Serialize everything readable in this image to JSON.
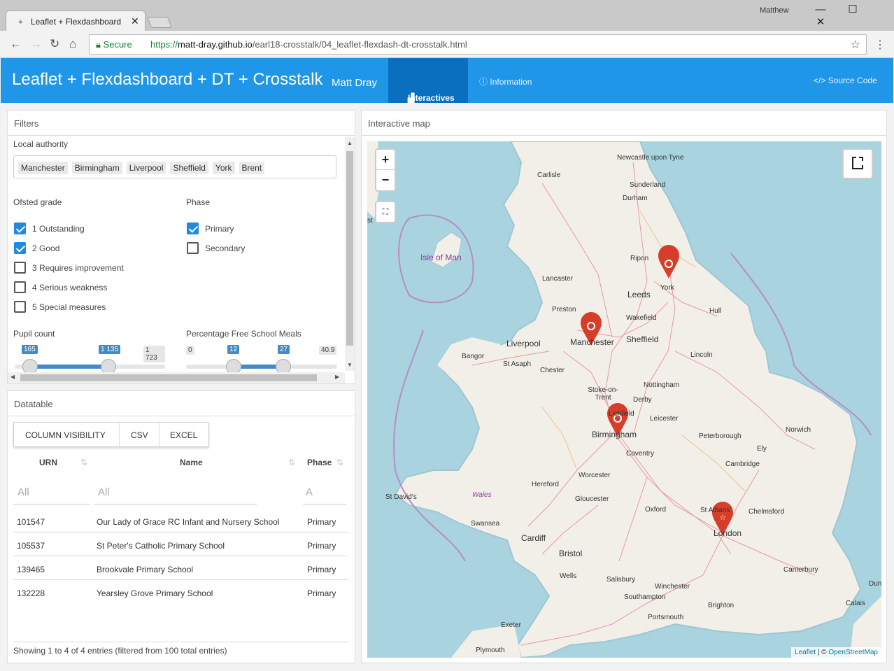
{
  "browser": {
    "tab_title": "Leaflet + Flexdashboard",
    "user": "Matthew",
    "secure_label": "Secure",
    "url_scheme": "https://",
    "url_host": "matt-dray.github.io",
    "url_path": "/earl18-crosstalk/04_leaflet-flexdash-dt-crosstalk.html"
  },
  "header": {
    "title": "Leaflet + Flexdashboard + DT + Crosstalk",
    "author": "Matt Dray",
    "nav_interactives": "Interactives",
    "nav_information": "Information",
    "source_code": "Source Code",
    "color": "#1f96e8"
  },
  "filters": {
    "title": "Filters",
    "local_authority_label": "Local authority",
    "local_authorities": [
      "Manchester",
      "Birmingham",
      "Liverpool",
      "Sheffield",
      "York",
      "Brent"
    ],
    "ofsted_label": "Ofsted grade",
    "ofsted": [
      {
        "label": "1 Outstanding",
        "checked": true
      },
      {
        "label": "2 Good",
        "checked": true
      },
      {
        "label": "3 Requires improvement",
        "checked": false
      },
      {
        "label": "4 Serious weakness",
        "checked": false
      },
      {
        "label": "5 Special measures",
        "checked": false
      }
    ],
    "phase_label": "Phase",
    "phase": [
      {
        "label": "Primary",
        "checked": true
      },
      {
        "label": "Secondary",
        "checked": false
      }
    ],
    "pupil_label": "Pupil count",
    "pupil": {
      "min": "165",
      "from": "165",
      "to": "1 135",
      "max": "1 723"
    },
    "fsm_label": "Percentage Free School Meals",
    "fsm": {
      "min": "0",
      "from": "12",
      "to": "27",
      "max": "40.9"
    }
  },
  "datatable": {
    "title": "Datatable",
    "buttons": [
      "COLUMN VISIBILITY",
      "CSV",
      "EXCEL"
    ],
    "columns": [
      "URN",
      "Name",
      "Phase"
    ],
    "filter_placeholders": [
      "All",
      "All",
      "A"
    ],
    "rows": [
      {
        "urn": "101547",
        "name": "Our Lady of Grace RC Infant and Nursery School",
        "phase": "Primary"
      },
      {
        "urn": "105537",
        "name": "St Peter's Catholic Primary School",
        "phase": "Primary"
      },
      {
        "urn": "139465",
        "name": "Brookvale Primary School",
        "phase": "Primary"
      },
      {
        "urn": "132228",
        "name": "Yearsley Grove Primary School",
        "phase": "Primary"
      }
    ],
    "info": "Showing 1 to 4 of 4 entries (filtered from 100 total entries)"
  },
  "map": {
    "title": "Interactive map",
    "zoom_in": "+",
    "zoom_out": "−",
    "attribution_leaflet": "Leaflet",
    "attribution_sep": " | © ",
    "attribution_osm": "OpenStreetMap",
    "places": [
      "Newcastle upon Tyne",
      "Carlisle",
      "Sunderland",
      "Durham",
      "Isle of Man",
      "Ripon",
      "York",
      "Lancaster",
      "Leeds",
      "Preston",
      "Wakefield",
      "Hull",
      "Liverpool",
      "Manchester",
      "Sheffield",
      "Bangor",
      "St Asaph",
      "Chester",
      "Lincoln",
      "Stoke-on-Trent",
      "Nottingham",
      "Derby",
      "Lichfield",
      "Leicester",
      "Birmingham",
      "Peterborough",
      "Norwich",
      "Coventry",
      "Ely",
      "Cambridge",
      "Hereford",
      "Worcester",
      "St David's",
      "Wales",
      "Gloucester",
      "Oxford",
      "St Albans",
      "Chelmsford",
      "Swansea",
      "Cardiff",
      "London",
      "Bristol",
      "Canterbury",
      "Wells",
      "Salisbury",
      "Winchester",
      "Southampton",
      "Brighton",
      "Portsmouth",
      "Exeter",
      "Plymouth",
      "Calais",
      "Dun",
      "st"
    ]
  }
}
